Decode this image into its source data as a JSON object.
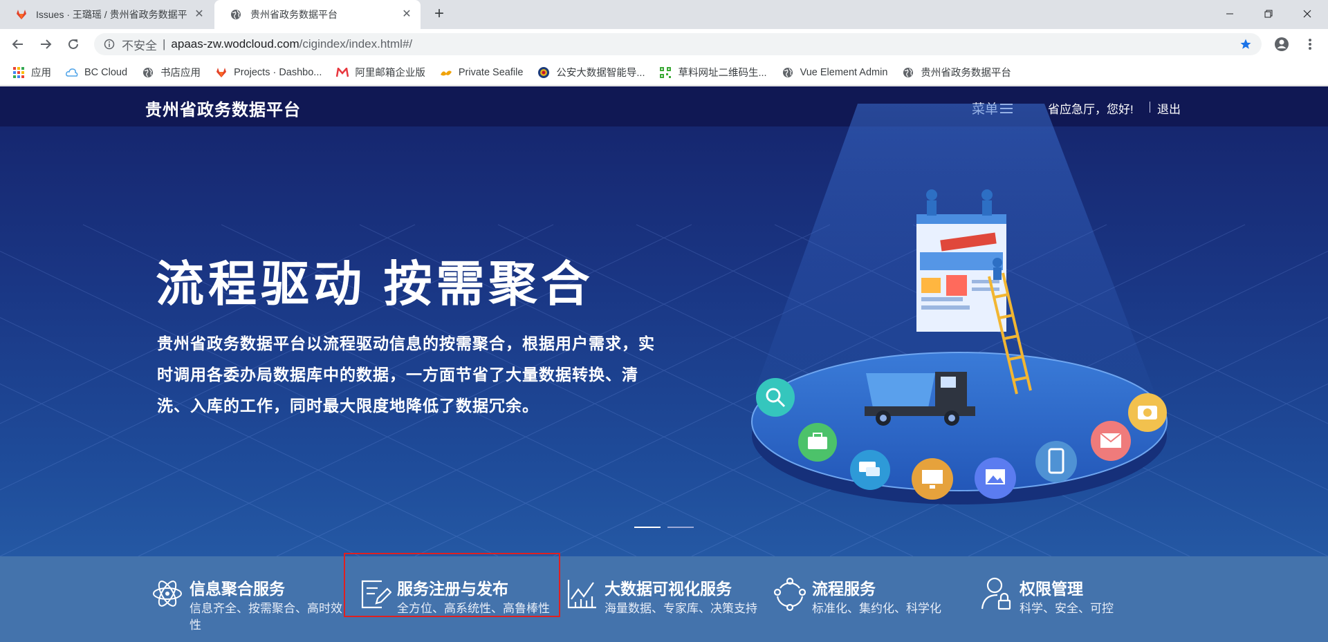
{
  "browser": {
    "tabs": [
      {
        "title": "Issues · 王璐瑶 / 贵州省政务数据平",
        "icon": "gitlab-fox-icon",
        "active": false
      },
      {
        "title": "贵州省政务数据平台",
        "icon": "globe-icon",
        "active": true
      }
    ],
    "address": {
      "security_label": "不安全",
      "separator": "|",
      "host": "apaas-zw.wodcloud.com",
      "path": "/cigindex/index.html#/"
    },
    "bookmarks": [
      {
        "label": "应用",
        "icon": "apps-grid-icon"
      },
      {
        "label": "BC Cloud",
        "icon": "cloud-icon"
      },
      {
        "label": "书店应用",
        "icon": "globe-icon"
      },
      {
        "label": "Projects · Dashbo...",
        "icon": "gitlab-fox-icon"
      },
      {
        "label": "阿里邮箱企业版",
        "icon": "mail-m-icon"
      },
      {
        "label": "Private Seafile",
        "icon": "seafile-icon"
      },
      {
        "label": "公安大数据智能导...",
        "icon": "police-badge-icon"
      },
      {
        "label": "草料网址二维码生...",
        "icon": "qr-code-icon"
      },
      {
        "label": "Vue Element Admin",
        "icon": "globe-icon"
      },
      {
        "label": "贵州省政务数据平台",
        "icon": "globe-icon"
      }
    ],
    "accent_star_color": "#1a73e8"
  },
  "header": {
    "site_title": "贵州省政务数据平台",
    "menu_label": "菜单",
    "greeting": "省应急厅，您好!",
    "logout": "退出"
  },
  "hero": {
    "title": "流程驱动  按需聚合",
    "description": "贵州省政务数据平台以流程驱动信息的按需聚合，根据用户需求，实时调用各委办局数据库中的数据，一方面节省了大量数据转换、清洗、入库的工作，同时最大限度地降低了数据冗余。",
    "carousel": {
      "slides": 2,
      "active": 1
    }
  },
  "services": [
    {
      "title": "信息聚合服务",
      "desc": "信息齐全、按需聚合、高时效性",
      "icon": "atom-icon"
    },
    {
      "title": "服务注册与发布",
      "desc": "全方位、高系统性、高鲁棒性",
      "icon": "edit-document-icon",
      "highlighted": true
    },
    {
      "title": "大数据可视化服务",
      "desc": "海量数据、专家库、决策支持",
      "icon": "line-chart-icon"
    },
    {
      "title": "流程服务",
      "desc": "标准化、集约化、科学化",
      "icon": "process-cycle-icon"
    },
    {
      "title": "权限管理",
      "desc": "科学、安全、可控",
      "icon": "user-lock-icon"
    }
  ],
  "colors": {
    "header_bg": "#0f1650",
    "hero_top": "#15236a",
    "hero_bottom": "#2a64ad",
    "services_bar": "#4473ac",
    "highlight_box": "#e02020"
  }
}
